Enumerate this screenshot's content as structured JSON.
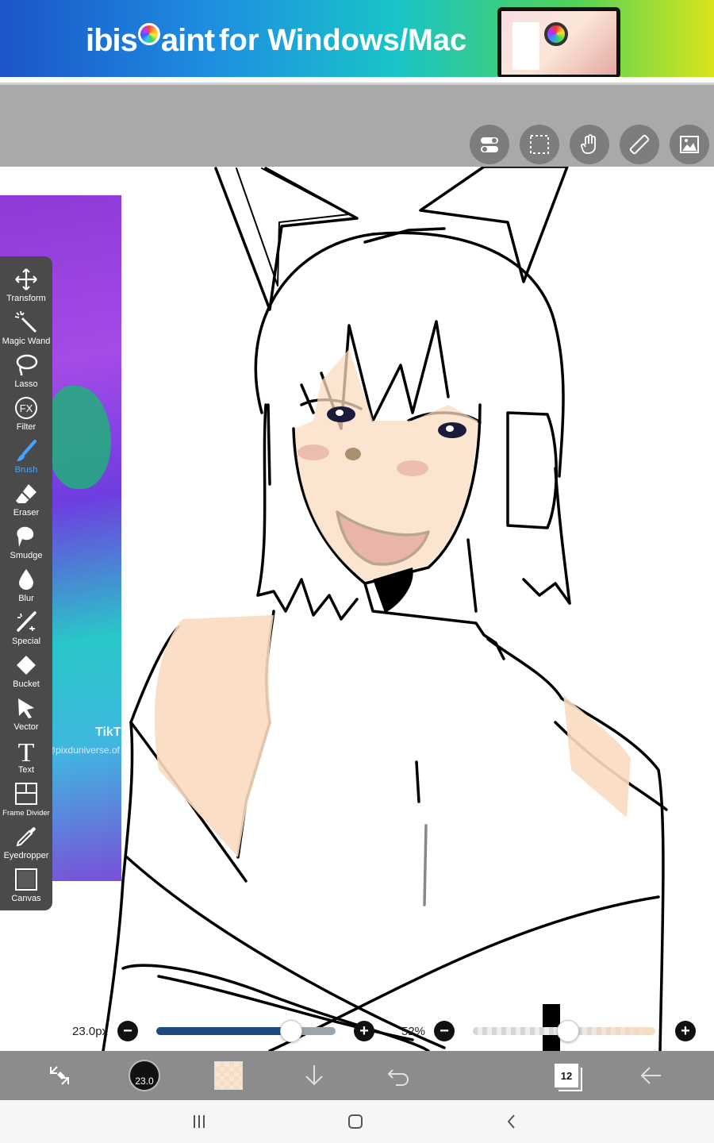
{
  "ad": {
    "logo_prefix": "ibis",
    "logo_suffix": "aint",
    "tagline": "for Windows/Mac"
  },
  "top_tools": [
    {
      "name": "toggle-icon"
    },
    {
      "name": "selection-layer-icon"
    },
    {
      "name": "hand-icon"
    },
    {
      "name": "ruler-icon"
    },
    {
      "name": "reference-image-icon"
    }
  ],
  "reference_image": {
    "text_1": "TikT",
    "text_2": "@pixduniverse.of"
  },
  "tools": [
    {
      "label": "Transform",
      "icon": "transform-icon"
    },
    {
      "label": "Magic Wand",
      "icon": "magic-wand-icon"
    },
    {
      "label": "Lasso",
      "icon": "lasso-icon"
    },
    {
      "label": "Filter",
      "icon": "filter-fx-icon",
      "glyph": "FX"
    },
    {
      "label": "Brush",
      "icon": "brush-icon",
      "active": true
    },
    {
      "label": "Eraser",
      "icon": "eraser-icon"
    },
    {
      "label": "Smudge",
      "icon": "smudge-icon"
    },
    {
      "label": "Blur",
      "icon": "blur-drop-icon"
    },
    {
      "label": "Special",
      "icon": "special-pen-icon"
    },
    {
      "label": "Bucket",
      "icon": "bucket-icon"
    },
    {
      "label": "Vector",
      "icon": "vector-arrow-icon"
    },
    {
      "label": "Text",
      "icon": "text-icon",
      "glyph": "T"
    },
    {
      "label": "Frame Divider",
      "icon": "frame-divider-icon"
    },
    {
      "label": "Eyedropper",
      "icon": "eyedropper-icon"
    },
    {
      "label": "Canvas",
      "icon": "canvas-icon"
    }
  ],
  "brush_size": {
    "label": "23.0px",
    "value_fraction": 0.75
  },
  "opacity": {
    "label": "52%",
    "value": 52
  },
  "bottom_bar": {
    "brush_size_value": "23.0",
    "color": "#f9dcc0",
    "layer_count": "12"
  },
  "colors": {
    "skin": "#f9dcc0",
    "blush": "#e8b4a4",
    "mouth": "#b8406a",
    "size_fill": "#1f4a80"
  }
}
